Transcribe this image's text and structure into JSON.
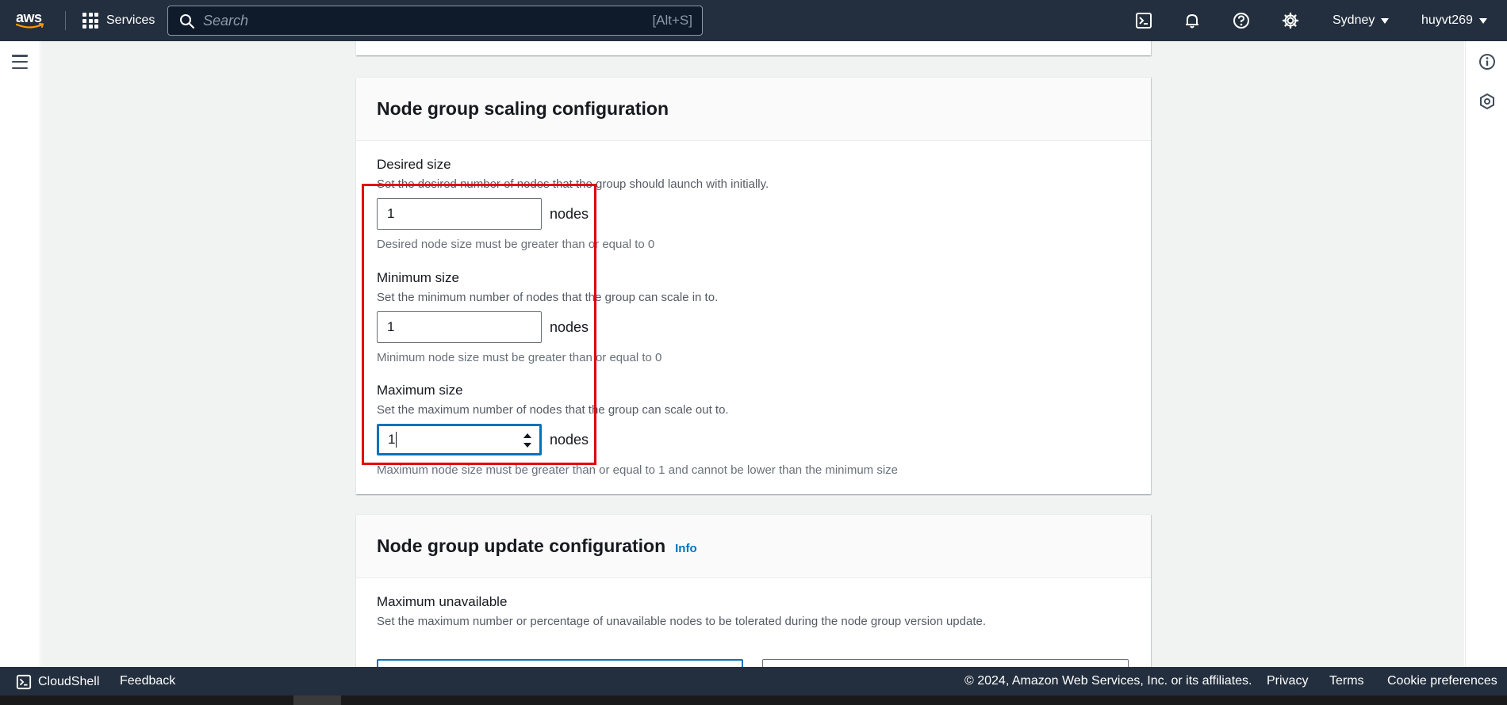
{
  "topnav": {
    "logo_text": "aws",
    "services_label": "Services",
    "search_placeholder": "Search",
    "search_shortcut": "[Alt+S]",
    "region": "Sydney",
    "user": "huyvt269",
    "icons": [
      "cloudshell-icon",
      "bell-icon",
      "help-icon",
      "gear-icon"
    ]
  },
  "sections": {
    "scaling": {
      "title": "Node group scaling configuration",
      "desired": {
        "label": "Desired size",
        "description": "Set the desired number of nodes that the group should launch with initially.",
        "value": "1",
        "unit": "nodes",
        "constraint": "Desired node size must be greater than or equal to 0"
      },
      "minimum": {
        "label": "Minimum size",
        "description": "Set the minimum number of nodes that the group can scale in to.",
        "value": "1",
        "unit": "nodes",
        "constraint": "Minimum node size must be greater than or equal to 0"
      },
      "maximum": {
        "label": "Maximum size",
        "description": "Set the maximum number of nodes that the group can scale out to.",
        "value": "1",
        "unit": "nodes",
        "constraint": "Maximum node size must be greater than or equal to 1 and cannot be lower than the minimum size"
      }
    },
    "update": {
      "title": "Node group update configuration",
      "info_label": "Info",
      "max_unavailable": {
        "label": "Maximum unavailable",
        "description": "Set the maximum number or percentage of unavailable nodes to be tolerated during the node group version update."
      }
    }
  },
  "footer": {
    "cloudshell": "CloudShell",
    "feedback": "Feedback",
    "copyright": "© 2024, Amazon Web Services, Inc. or its affiliates.",
    "privacy": "Privacy",
    "terms": "Terms",
    "cookie": "Cookie preferences"
  },
  "colors": {
    "nav_bg": "#232f3e",
    "accent": "#0073bb",
    "highlight": "#e1000f"
  }
}
